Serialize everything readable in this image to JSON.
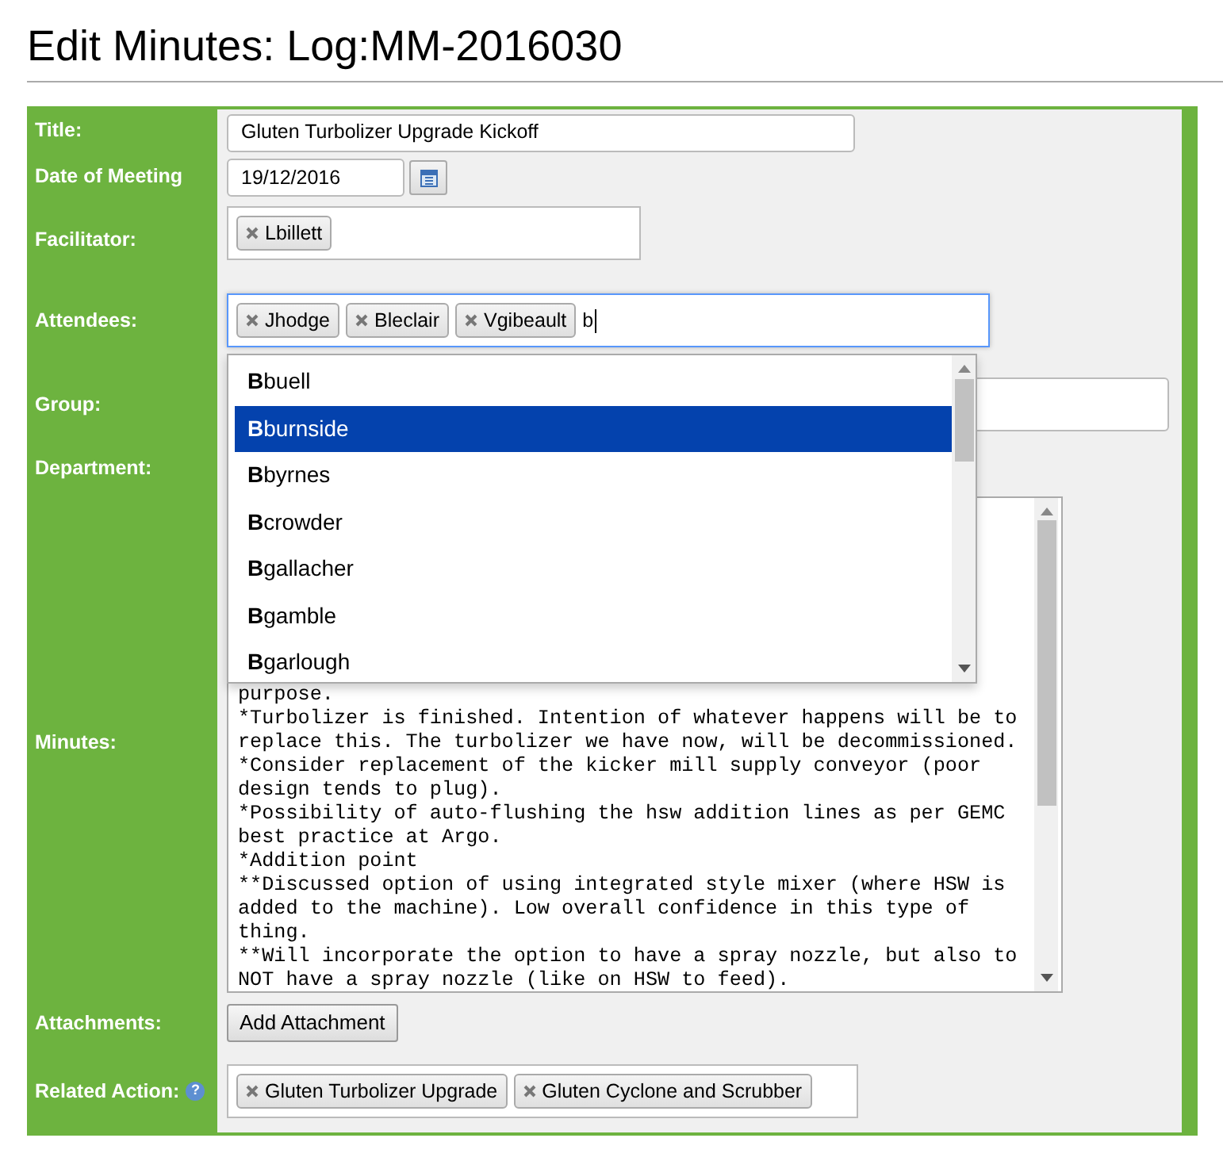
{
  "page_title": "Edit Minutes: Log:MM-2016030",
  "fields": [
    {
      "kind": "text",
      "label": "Title:",
      "value": "Gluten Turbolizer Upgrade Kickoff"
    },
    {
      "kind": "date",
      "label": "Date of Meeting",
      "value": "19/12/2016"
    },
    {
      "kind": "tokens",
      "label": "Facilitator:",
      "tokens": [
        "Lbillett"
      ],
      "focused": false
    },
    {
      "kind": "tokens",
      "label": "Attendees:",
      "tokens": [
        "Jhodge",
        "Bleclair",
        "Vgibeault"
      ],
      "typed": "b",
      "focused": true
    },
    {
      "kind": "text",
      "label": "Group:"
    },
    {
      "kind": "blank",
      "label": "Department:"
    },
    {
      "kind": "textarea",
      "label": "Minutes:",
      "text": "purpose.\n*Turbolizer is finished. Intention of whatever happens will be to\nreplace this. The turbolizer we have now, will be decommissioned.\n*Consider replacement of the kicker mill supply conveyor (poor\ndesign tends to plug).\n*Possibility of auto-flushing the hsw addition lines as per GEMC\nbest practice at Argo.\n*Addition point\n**Discussed option of using integrated style mixer (where HSW is\nadded to the machine). Low overall confidence in this type of\nthing.\n**Will incorporate the option to have a spray nozzle, but also to\nNOT have a spray nozzle (like on HSW to feed)."
    },
    {
      "kind": "button",
      "label": "Attachments:",
      "button": "Add Attachment"
    },
    {
      "kind": "tokens",
      "label": "Related Action:",
      "help": "?",
      "tokens": [
        "Gluten Turbolizer Upgrade",
        "Gluten Cyclone and Scrubber"
      ],
      "focused": false
    }
  ],
  "autocomplete": {
    "options": [
      {
        "label": "**B**buell",
        "selected": false
      },
      {
        "label": "**B**burnside",
        "selected": true
      },
      {
        "label": "**B**byrnes",
        "selected": false
      },
      {
        "label": "**B**crowder",
        "selected": false
      },
      {
        "label": "**B**gallacher",
        "selected": false
      },
      {
        "label": "**B**gamble",
        "selected": false
      },
      {
        "label": "**B**garlough",
        "selected": false
      }
    ]
  }
}
